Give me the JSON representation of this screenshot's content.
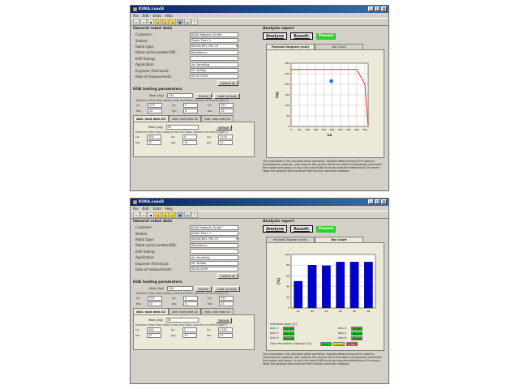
{
  "window_title": "KUKA.Load3",
  "menu": [
    "File",
    "Edit",
    "Units",
    "Help"
  ],
  "general": {
    "title": "General robot data",
    "fields": [
      {
        "label": "Customer:",
        "value": "KUKA Robotics GmbH"
      },
      {
        "label": "Station:",
        "value": "Power Pram 1"
      },
      {
        "label": "Robot type:",
        "value": "KR200/KR1.7R3.75"
      },
      {
        "label": "Robot serial number(SN):",
        "value": "Robodemo"
      },
      {
        "label": "EOA Tooling:",
        "value": ""
      },
      {
        "label": "Application:",
        "value": "Arc Handling"
      },
      {
        "label": "Engineer (Technical):",
        "value": "Mr. W.Robi"
      },
      {
        "label": "Date of measurement:",
        "value": "06.02.2009"
      }
    ],
    "default_button": "Default all"
  },
  "eoa": {
    "title": "EOA tooling parameters",
    "mass_label": "Mass [kg]:",
    "mass_value": "100",
    "unload_button": "Unload",
    "load_up_button": "Load up mass",
    "note": "Distance (from face plate) [mm] and Mass moment of inertia [kgm²]:",
    "lx": "Lx:",
    "lx_val": "245",
    "ly": "Ly:",
    "ly_val": "0",
    "lz": "Lz:",
    "lz_val": "345",
    "ixx": "Ixx:",
    "ixx_val": "10",
    "iyy": "Iyy:",
    "iyy_val": "8",
    "izz": "Izz:",
    "izz_val": "10"
  },
  "load_tabs": [
    "Add. load data A3",
    "Add. load data A2",
    "Add. load data A1"
  ],
  "addload": {
    "mass_label": "Mass [kg]:",
    "mass_value": "50",
    "default_button": "Default",
    "note": "Distance (from face plate) [mm] and Mass moment of inertia [kgm²]:",
    "lx": "Lx:",
    "lx_val": "400",
    "ly": "Ly:",
    "ly_val": "0",
    "lz": "Lz:",
    "lz_val": "1100",
    "ixx": "Ixx:",
    "ixx_val": "10",
    "iyy": "Iyy:",
    "iyy_val": "10",
    "izz": "Izz:",
    "izz_val": "10"
  },
  "analysis": {
    "title": "Analysis report",
    "analyse": "Analyse",
    "result": "Result:",
    "passed": "Passed",
    "passed_color": "#33cc33",
    "chart_tabs": [
      "Payload Diagram [mm]",
      "Bar Chart"
    ],
    "description": "This evaluation is for standard robot operation. Reliable determining of the robot or exceeding its capacity, also reduces the service life of the robot and generally overloads the motors and gears; in any such case KUKA must be consulted beforehand. For every robot the payload data must be filed into the controller software."
  },
  "chart_data": [
    {
      "type": "line",
      "xlabel": "Lx",
      "ylabel": "Lzy",
      "x_ticks": [
        "0",
        "50",
        "100",
        "150",
        "200",
        "250",
        "300",
        "350",
        "400",
        "450"
      ],
      "y_ticks": [
        "0",
        "50",
        "100",
        "150",
        "200",
        "250",
        "300"
      ],
      "series": [
        {
          "values": [
            [
              0,
              270
            ],
            [
              400,
              270
            ],
            [
              450,
              200
            ],
            [
              470,
              0
            ]
          ],
          "color": "#ff0000"
        }
      ],
      "point": {
        "x": 245,
        "y": 215,
        "color": "#3366ff"
      },
      "xlim": [
        0,
        470
      ],
      "ylim": [
        0,
        300
      ],
      "grid": true
    },
    {
      "type": "bar",
      "ylabel": "[%]",
      "categories": [
        "A1",
        "A2",
        "A3",
        "A4",
        "A5",
        "A6"
      ],
      "values": [
        50,
        80,
        79,
        86,
        86,
        86
      ],
      "ylim": [
        0,
        100
      ],
      "y_ticks": [
        "0",
        "20",
        "40",
        "60",
        "80",
        "100"
      ],
      "color": "#0000cc",
      "grid": true,
      "loads": {
        "title": "Individual loads [%]",
        "rows": [
          {
            "l1": "Axis 1:",
            "v1": "53.55%",
            "l2": "Axis 4:",
            "v2": "86.88%"
          },
          {
            "l1": "Axis 2:",
            "v1": "80.77%",
            "l2": "Axis 5:",
            "v2": "86.47%"
          },
          {
            "l1": "Axis 3:",
            "v1": "80.40%",
            "l2": "Axis 6:",
            "v2": "86.50%"
          }
        ],
        "capacity_label": "Color description (capacity) [%]:",
        "cap": [
          "< 75",
          "75-100",
          "> 100"
        ]
      }
    }
  ]
}
